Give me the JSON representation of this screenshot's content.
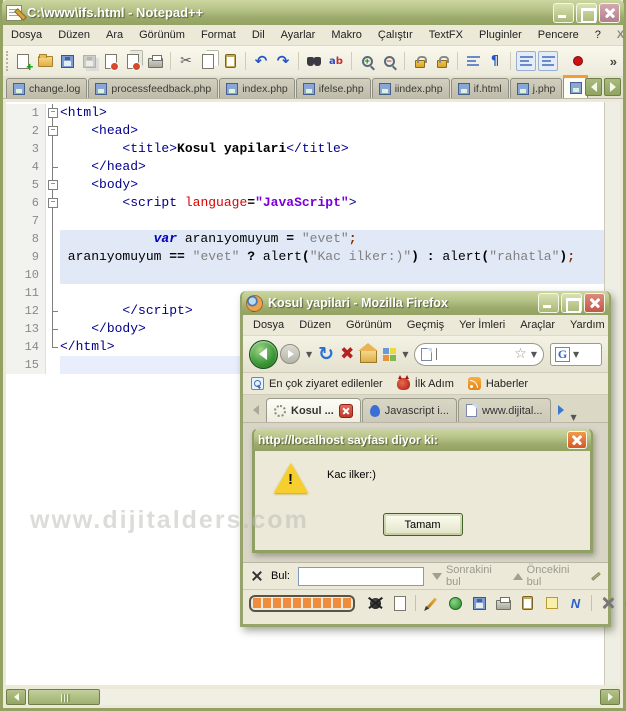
{
  "watermark": "www.dijitalders.com",
  "colors": {
    "olive_chrome": "#9cab6c",
    "active_tab_accent": "#f49b36",
    "progress_orange": "#ef8c3e",
    "selection_blue": "#e2e9f6"
  },
  "notepad": {
    "title": "C:\\www\\ifs.html - Notepad++",
    "menu": [
      "Dosya",
      "Düzen",
      "Ara",
      "Görünüm",
      "Format",
      "Dil",
      "Ayarlar",
      "Makro",
      "Çalıştır",
      "TextFX",
      "Pluginler",
      "Pencere",
      "?"
    ],
    "menu_close": "X",
    "toolbar_overflow": "»",
    "toolbar": [
      "new-file",
      "open-file",
      "save",
      "save-all:dis",
      "close-file",
      "close-all",
      "print",
      "|",
      "cut",
      "copy",
      "paste",
      "|",
      "undo",
      "redo",
      "|",
      "find",
      "replace",
      "|",
      "zoom-in",
      "zoom-out",
      "|",
      "sync-scroll-v",
      "sync-scroll-h",
      "|",
      "word-wrap",
      "show-all-chars",
      "|",
      "doc-map:on",
      "function-list:on",
      "record-macro"
    ],
    "glyphs": {
      "cut": "✂",
      "undo": "↶",
      "redo": "↷",
      "show-all-chars": "¶",
      "fold_minus": "−"
    },
    "tabs": [
      "change.log",
      "processfeedback.php",
      "index.php",
      "ifelse.php",
      "iindex.php",
      "if.html",
      "j.php"
    ],
    "code": {
      "lines": [
        {
          "n": "1",
          "bg": "",
          "fold": "box",
          "segs": [
            [
              "<html>",
              "tag"
            ]
          ]
        },
        {
          "n": "2",
          "bg": "",
          "fold": "box",
          "segs": [
            [
              "    ",
              ""
            ],
            [
              "<head>",
              "tag"
            ]
          ]
        },
        {
          "n": "3",
          "bg": "",
          "fold": "line",
          "segs": [
            [
              "        ",
              ""
            ],
            [
              "<title>",
              "tag"
            ],
            [
              "Kosul yapilari",
              "boldtext"
            ],
            [
              "</title>",
              "tag"
            ]
          ]
        },
        {
          "n": "4",
          "bg": "",
          "fold": "tick",
          "segs": [
            [
              "    ",
              ""
            ],
            [
              "</head>",
              "tag"
            ]
          ]
        },
        {
          "n": "5",
          "bg": "",
          "fold": "box",
          "segs": [
            [
              "    ",
              ""
            ],
            [
              "<body>",
              "tag"
            ]
          ]
        },
        {
          "n": "6",
          "bg": "",
          "fold": "box",
          "segs": [
            [
              "        ",
              ""
            ],
            [
              "<script ",
              "tag"
            ],
            [
              "language",
              "attr"
            ],
            [
              "=",
              "op"
            ],
            [
              "\"JavaScript\"",
              "value"
            ],
            [
              ">",
              "tag"
            ]
          ]
        },
        {
          "n": "7",
          "bg": "",
          "fold": "line",
          "segs": []
        },
        {
          "n": "8",
          "bg": "sel",
          "fold": "line",
          "segs": [
            [
              "            ",
              ""
            ],
            [
              "var",
              "kw"
            ],
            [
              " aranıyomuyum ",
              ""
            ],
            [
              "=",
              "op"
            ],
            [
              " ",
              ""
            ],
            [
              "\"evet\"",
              "str"
            ],
            [
              ";",
              "semi"
            ]
          ]
        },
        {
          "n": "9",
          "bg": "sel",
          "fold": "line",
          "segs": [
            [
              " aranıyomuyum ",
              ""
            ],
            [
              "==",
              "op"
            ],
            [
              " ",
              ""
            ],
            [
              "\"evet\"",
              "str"
            ],
            [
              " ",
              ""
            ],
            [
              "?",
              "op"
            ],
            [
              " alert",
              ""
            ],
            [
              "(",
              "op"
            ],
            [
              "\"Kac ilker:)\"",
              "str"
            ],
            [
              ")",
              "op"
            ],
            [
              " ",
              ""
            ],
            [
              ":",
              "op"
            ],
            [
              " alert",
              ""
            ],
            [
              "(",
              "op"
            ],
            [
              "\"rahatla\"",
              "str"
            ],
            [
              ")",
              "op"
            ],
            [
              ";",
              "semi"
            ]
          ]
        },
        {
          "n": "10",
          "bg": "sel",
          "fold": "line",
          "segs": []
        },
        {
          "n": "11",
          "bg": "",
          "fold": "line",
          "segs": []
        },
        {
          "n": "12",
          "bg": "",
          "fold": "tick",
          "segs": [
            [
              "        ",
              ""
            ],
            [
              "</script>",
              "tag"
            ]
          ]
        },
        {
          "n": "13",
          "bg": "",
          "fold": "tick",
          "segs": [
            [
              "    ",
              ""
            ],
            [
              "</body>",
              "tag"
            ]
          ]
        },
        {
          "n": "14",
          "bg": "",
          "fold": "corner",
          "segs": [
            [
              "</html>",
              "tag"
            ]
          ]
        },
        {
          "n": "15",
          "bg": "cur",
          "fold": "none",
          "segs": []
        }
      ]
    }
  },
  "firefox": {
    "title": "Kosul yapilari - Mozilla Firefox",
    "menu": [
      "Dosya",
      "Düzen",
      "Görünüm",
      "Geçmiş",
      "Yer İmleri",
      "Araçlar",
      "Yardım"
    ],
    "bookmarks": [
      {
        "label": "En çok ziyaret edilenler",
        "icon": "magnifier"
      },
      {
        "label": "İlk Adım",
        "icon": "devil"
      },
      {
        "label": "Haberler",
        "icon": "rss"
      }
    ],
    "search_logo": "G",
    "tabs": [
      {
        "label": "Kosul ...",
        "icon": "spinner",
        "active": true,
        "close": true
      },
      {
        "label": "Javascript i...",
        "icon": "js",
        "active": false,
        "close": false
      },
      {
        "label": "www.dijital...",
        "icon": "page",
        "active": false,
        "close": false
      }
    ],
    "findbar": {
      "label": "Bul:",
      "value": "",
      "next": "Sonrakini bul",
      "prev": "Öncekini bul"
    },
    "statusbar": {
      "progress_segments": 10,
      "icons": [
        "bug",
        "new-page",
        "sep",
        "pencil",
        "globe",
        "floppy",
        "printer",
        "clipboard",
        "note",
        "lightning",
        "sep",
        "tools",
        "info"
      ]
    }
  },
  "dialog": {
    "title": "http://localhost sayfası diyor ki:",
    "message": "Kac ilker:)",
    "ok_label": "Tamam"
  }
}
